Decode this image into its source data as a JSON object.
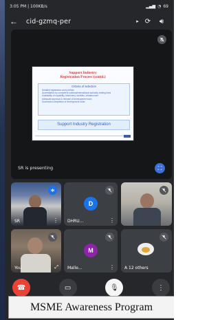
{
  "status_bar": {
    "time": "3:05 PM",
    "speed": "100KB/s",
    "battery": "69"
  },
  "meeting": {
    "code": "cid-gzmq-per"
  },
  "presentation": {
    "presenter_label": "SR is presenting",
    "slide": {
      "title_line1": "Support Industry",
      "title_line2": "Registration Process (contd.)",
      "criteria_heading": "Criteria of selection",
      "criteria": [
        "Detailed registration and portfolio",
        "Accreditation by competent national/international authority, testing lines",
        "Availability of capability, Machinery, facilities, infrastructure",
        "Adequate approval & relevant of development work",
        "Successful completion of development order"
      ],
      "button_label": "Support Industry Registration"
    }
  },
  "participants": [
    {
      "name": "SR",
      "avatar": ""
    },
    {
      "name": "DHRU...",
      "avatar": "D",
      "avatar_color": "#1a73e8"
    },
    {
      "name": "",
      "avatar": ""
    },
    {
      "name": "You",
      "avatar": ""
    },
    {
      "name": "Malle...",
      "avatar": "M",
      "avatar_color": "#8e24aa"
    },
    {
      "name": "A 12 others",
      "avatar": ""
    }
  ],
  "banner": {
    "text": "MSME Awareness Program"
  }
}
